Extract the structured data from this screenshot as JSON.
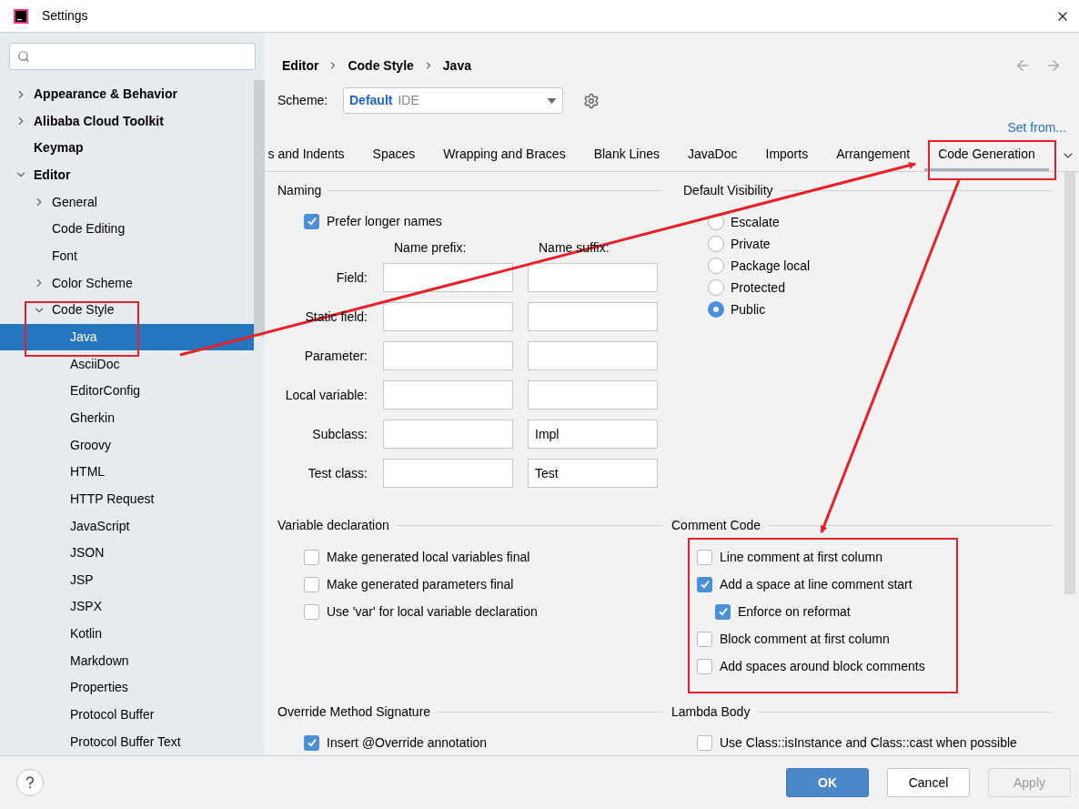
{
  "window": {
    "title": "Settings"
  },
  "sidebar": {
    "items": [
      {
        "label": "Appearance & Behavior",
        "expanded": false,
        "selected": false
      },
      {
        "label": "Alibaba Cloud Toolkit",
        "expanded": false,
        "selected": false
      },
      {
        "label": "Keymap",
        "selected": false
      },
      {
        "label": "Editor",
        "expanded": true,
        "selected": false,
        "children": [
          {
            "label": "General",
            "expanded": false,
            "selected": false
          },
          {
            "label": "Code Editing",
            "selected": false
          },
          {
            "label": "Font",
            "selected": false
          },
          {
            "label": "Color Scheme",
            "expanded": false,
            "selected": false
          },
          {
            "label": "Code Style",
            "expanded": true,
            "selected": false,
            "children": [
              {
                "label": "Java",
                "selected": true
              },
              {
                "label": "AsciiDoc",
                "selected": false
              },
              {
                "label": "EditorConfig",
                "selected": false
              },
              {
                "label": "Gherkin",
                "selected": false
              },
              {
                "label": "Groovy",
                "selected": false
              },
              {
                "label": "HTML",
                "selected": false
              },
              {
                "label": "HTTP Request",
                "selected": false
              },
              {
                "label": "JavaScript",
                "selected": false
              },
              {
                "label": "JSON",
                "selected": false
              },
              {
                "label": "JSP",
                "selected": false
              },
              {
                "label": "JSPX",
                "selected": false
              },
              {
                "label": "Kotlin",
                "selected": false
              },
              {
                "label": "Markdown",
                "selected": false
              },
              {
                "label": "Properties",
                "selected": false
              },
              {
                "label": "Protocol Buffer",
                "selected": false
              },
              {
                "label": "Protocol Buffer Text",
                "selected": false
              }
            ]
          }
        ]
      }
    ]
  },
  "breadcrumb": [
    "Editor",
    "Code Style",
    "Java"
  ],
  "scheme": {
    "label": "Scheme:",
    "name": "Default",
    "scope": "IDE"
  },
  "set_from": "Set from...",
  "tabs": [
    {
      "label": "s and Indents",
      "selected": false
    },
    {
      "label": "Spaces",
      "selected": false
    },
    {
      "label": "Wrapping and Braces",
      "selected": false
    },
    {
      "label": "Blank Lines",
      "selected": false
    },
    {
      "label": "JavaDoc",
      "selected": false
    },
    {
      "label": "Imports",
      "selected": false
    },
    {
      "label": "Arrangement",
      "selected": false
    },
    {
      "label": "Code Generation",
      "selected": true
    }
  ],
  "naming": {
    "title": "Naming",
    "prefer_longer": {
      "label": "Prefer longer names",
      "checked": true
    },
    "columns": [
      "Name prefix:",
      "Name suffix:"
    ],
    "rows": [
      {
        "label": "Field:"
      },
      {
        "label": "Static field:"
      },
      {
        "label": "Parameter:"
      },
      {
        "label": "Local variable:"
      },
      {
        "label": "Subclass:",
        "suffix": "Impl"
      },
      {
        "label": "Test class:",
        "suffix": "Test"
      }
    ]
  },
  "default_visibility": {
    "title": "Default Visibility",
    "options": [
      {
        "label": "Escalate",
        "selected": false
      },
      {
        "label": "Private",
        "selected": false
      },
      {
        "label": "Package local",
        "selected": false
      },
      {
        "label": "Protected",
        "selected": false
      },
      {
        "label": "Public",
        "selected": true
      }
    ]
  },
  "variable_declaration": {
    "title": "Variable declaration",
    "options": [
      {
        "label": "Make generated local variables final",
        "checked": false
      },
      {
        "label": "Make generated parameters final",
        "checked": false
      },
      {
        "label": "Use 'var' for local variable declaration",
        "checked": false
      }
    ]
  },
  "comment_code": {
    "title": "Comment Code",
    "options": [
      {
        "label": "Line comment at first column",
        "checked": false
      },
      {
        "label": "Add a space at line comment start",
        "checked": true,
        "children": [
          {
            "label": "Enforce on reformat",
            "checked": true
          }
        ]
      },
      {
        "label": "Block comment at first column",
        "checked": false
      },
      {
        "label": "Add spaces around block comments",
        "checked": false
      }
    ]
  },
  "override": {
    "title": "Override Method Signature",
    "options": [
      {
        "label": "Insert @Override annotation",
        "checked": true
      }
    ]
  },
  "lambda_body": {
    "title": "Lambda Body",
    "options": [
      {
        "label": "Use Class::isInstance and Class::cast when possible",
        "checked": false
      }
    ]
  },
  "buttons": [
    {
      "label": "OK",
      "kind": "primary"
    },
    {
      "label": "Cancel",
      "kind": "normal"
    },
    {
      "label": "Apply",
      "kind": "disabled"
    }
  ],
  "annotation_marks": true
}
